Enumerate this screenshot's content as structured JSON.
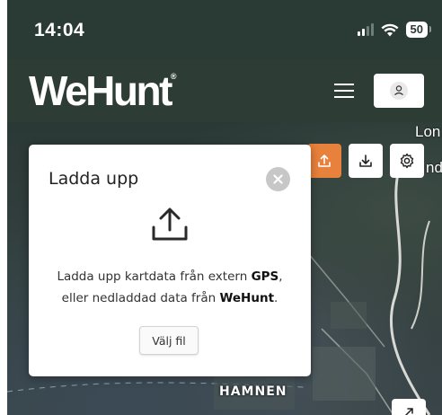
{
  "status_bar": {
    "time": "14:04",
    "battery": "50"
  },
  "header": {
    "logo_text": "WeHunt",
    "logo_mark": "®"
  },
  "map": {
    "labels": {
      "top_right": "Lon",
      "right": "nd",
      "harbor": "HAMNEN"
    }
  },
  "toolbar": {
    "upload_icon": "upload-icon",
    "download_icon": "download-icon",
    "settings_icon": "gear-icon",
    "upload_color": "#e8813c"
  },
  "upload_dialog": {
    "title": "Ladda upp",
    "text_part1": "Ladda upp kartdata från extern ",
    "text_gps": "GPS",
    "text_part2": ",",
    "text_part3": "eller nedladdad data från ",
    "text_wehunt": "WeHunt",
    "text_part4": ".",
    "choose_file_label": "Välj fil"
  },
  "colors": {
    "header_bg": "#2e3c36",
    "accent_orange": "#e8813c"
  }
}
